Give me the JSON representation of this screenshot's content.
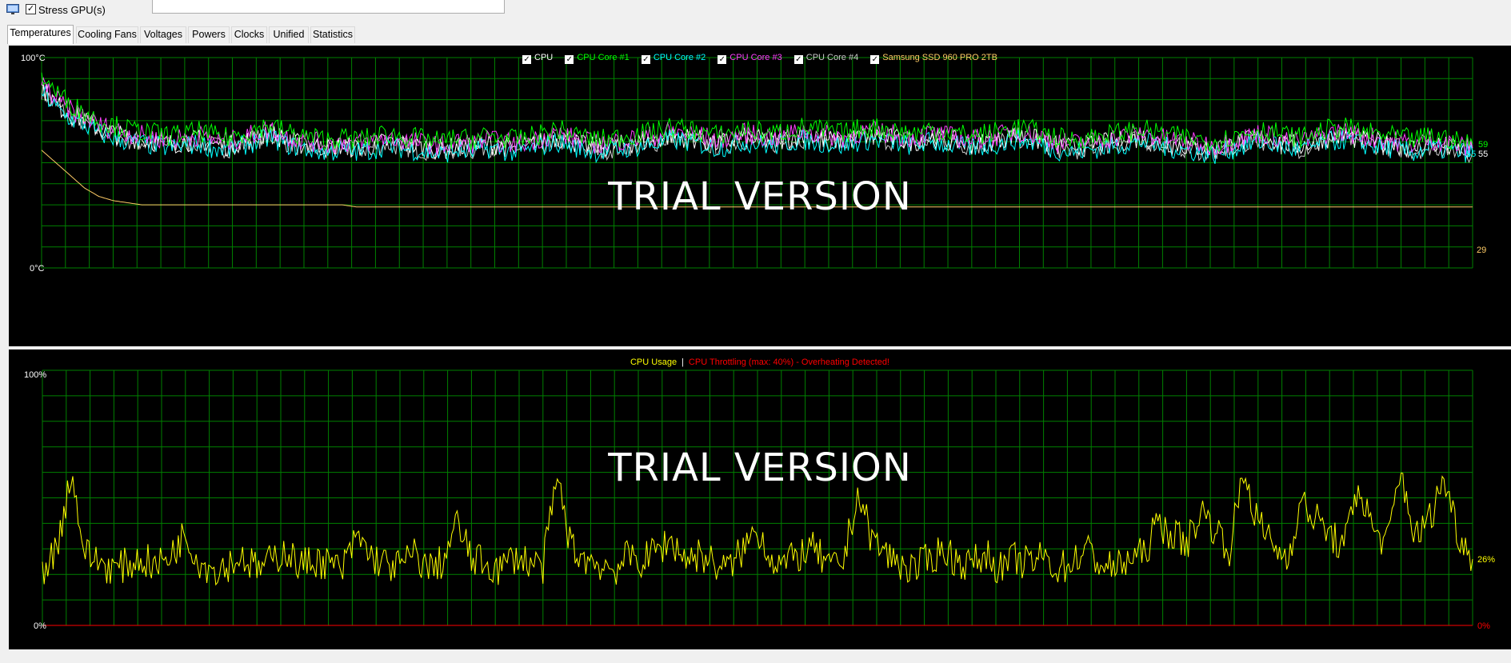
{
  "toolbar": {
    "stress_gpu_checked": true,
    "stress_gpu_label": "Stress GPU(s)"
  },
  "tabs": [
    {
      "label": "Temperatures",
      "active": true
    },
    {
      "label": "Cooling Fans"
    },
    {
      "label": "Voltages"
    },
    {
      "label": "Powers"
    },
    {
      "label": "Clocks"
    },
    {
      "label": "Unified"
    },
    {
      "label": "Statistics"
    }
  ],
  "temp_panel": {
    "legend": [
      {
        "label": "CPU",
        "color": "#ffffff",
        "checked": true
      },
      {
        "label": "CPU Core #1",
        "color": "#00ff00",
        "checked": true
      },
      {
        "label": "CPU Core #2",
        "color": "#00ffff",
        "checked": true
      },
      {
        "label": "CPU Core #3",
        "color": "#ff40ff",
        "checked": true
      },
      {
        "label": "CPU Core #4",
        "color": "#c8c8c8",
        "checked": true
      },
      {
        "label": "Samsung SSD 960 PRO 2TB",
        "color": "#ffcc66",
        "checked": true
      }
    ],
    "y_top_label": "100°C",
    "y_bottom_label": "0°C",
    "end_labels": [
      {
        "text": "59",
        "color": "#00ff00"
      },
      {
        "text": "55",
        "color": "#00ffff"
      },
      {
        "text": "55",
        "color": "#ffffff"
      },
      {
        "text": "29",
        "color": "#ffcc66"
      }
    ],
    "watermark": "TRIAL VERSION"
  },
  "cpu_panel": {
    "legend_usage": "CPU Usage",
    "legend_separator": "|",
    "legend_throttle": "CPU Throttling (max: 40%) - Overheating Detected!",
    "usage_color": "#ffff00",
    "throttle_color": "#ff0000",
    "y_top_label": "100%",
    "y_bottom_label": "0%",
    "end_usage_label": "26%",
    "end_throttle_label": "0%",
    "watermark": "TRIAL VERSION"
  },
  "chart_data": [
    {
      "type": "line",
      "title": "",
      "ylabel": "",
      "ylim": [
        0,
        100
      ],
      "grid": true,
      "legend_placement": "top-center",
      "series": [
        {
          "name": "CPU",
          "values": [
            86,
            78,
            73,
            70,
            66,
            64,
            62,
            61,
            60,
            59,
            60,
            61,
            59,
            58,
            60,
            62,
            64,
            61,
            59,
            58,
            57,
            58,
            57,
            58,
            60,
            59,
            58,
            57,
            56,
            58,
            57,
            59,
            58,
            57,
            58,
            60,
            62,
            60,
            58,
            57,
            58,
            59,
            60,
            61,
            63,
            62,
            61,
            59,
            60,
            62,
            61,
            60,
            61,
            63,
            62,
            61,
            60,
            62,
            63,
            62,
            61,
            60,
            62,
            61,
            60,
            59,
            60,
            61,
            63,
            62,
            60,
            58,
            57,
            58,
            59,
            60,
            61,
            62,
            60,
            59,
            58,
            57,
            56,
            58,
            60,
            62,
            61,
            59,
            58,
            60,
            62,
            63,
            61,
            60,
            59,
            58,
            57,
            59,
            58,
            56,
            55
          ]
        },
        {
          "name": "CPU Core #1",
          "values": [
            92,
            84,
            78,
            74,
            70,
            68,
            66,
            65,
            64,
            63,
            64,
            65,
            63,
            62,
            64,
            66,
            68,
            65,
            63,
            62,
            61,
            62,
            61,
            62,
            64,
            63,
            62,
            61,
            60,
            62,
            61,
            63,
            62,
            61,
            62,
            64,
            66,
            64,
            62,
            61,
            62,
            63,
            64,
            65,
            67,
            66,
            65,
            63,
            64,
            66,
            65,
            64,
            65,
            67,
            66,
            65,
            64,
            66,
            67,
            66,
            65,
            64,
            66,
            65,
            64,
            63,
            64,
            65,
            67,
            66,
            64,
            62,
            61,
            62,
            63,
            64,
            65,
            66,
            64,
            63,
            62,
            61,
            60,
            62,
            64,
            66,
            65,
            63,
            62,
            64,
            66,
            67,
            65,
            64,
            63,
            62,
            61,
            63,
            62,
            60,
            59
          ]
        },
        {
          "name": "CPU Core #2",
          "values": [
            84,
            76,
            71,
            68,
            64,
            62,
            60,
            59,
            58,
            57,
            58,
            59,
            57,
            56,
            58,
            60,
            62,
            59,
            57,
            56,
            55,
            56,
            55,
            56,
            58,
            57,
            56,
            55,
            54,
            56,
            55,
            57,
            56,
            55,
            56,
            58,
            60,
            58,
            56,
            55,
            56,
            57,
            58,
            59,
            61,
            60,
            59,
            57,
            58,
            60,
            59,
            58,
            59,
            61,
            60,
            59,
            58,
            60,
            61,
            60,
            59,
            58,
            60,
            59,
            58,
            57,
            58,
            59,
            61,
            60,
            58,
            56,
            55,
            56,
            57,
            58,
            59,
            60,
            58,
            57,
            56,
            55,
            54,
            56,
            58,
            60,
            59,
            57,
            56,
            58,
            60,
            61,
            59,
            58,
            57,
            56,
            55,
            57,
            56,
            55,
            55
          ]
        },
        {
          "name": "CPU Core #3",
          "values": [
            88,
            80,
            75,
            72,
            68,
            66,
            64,
            63,
            62,
            61,
            62,
            63,
            61,
            60,
            62,
            64,
            66,
            63,
            61,
            60,
            59,
            60,
            59,
            60,
            62,
            61,
            60,
            59,
            58,
            60,
            59,
            61,
            60,
            59,
            60,
            62,
            64,
            62,
            60,
            59,
            60,
            61,
            62,
            63,
            65,
            64,
            63,
            61,
            62,
            64,
            63,
            62,
            63,
            65,
            64,
            63,
            62,
            64,
            65,
            64,
            63,
            62,
            64,
            63,
            62,
            61,
            62,
            63,
            65,
            64,
            62,
            60,
            59,
            60,
            61,
            62,
            63,
            64,
            62,
            61,
            60,
            59,
            58,
            60,
            62,
            64,
            63,
            61,
            60,
            62,
            64,
            65,
            63,
            62,
            61,
            60,
            59,
            61,
            60,
            58,
            57
          ]
        },
        {
          "name": "CPU Core #4",
          "values": [
            85,
            77,
            72,
            69,
            65,
            63,
            61,
            60,
            59,
            58,
            59,
            60,
            58,
            57,
            59,
            61,
            63,
            60,
            58,
            57,
            56,
            57,
            56,
            57,
            59,
            58,
            57,
            56,
            55,
            57,
            56,
            58,
            57,
            56,
            57,
            59,
            61,
            59,
            57,
            56,
            57,
            58,
            59,
            60,
            62,
            61,
            60,
            58,
            59,
            61,
            60,
            59,
            60,
            62,
            61,
            60,
            59,
            61,
            62,
            61,
            60,
            59,
            61,
            60,
            59,
            58,
            59,
            60,
            62,
            61,
            59,
            57,
            56,
            57,
            58,
            59,
            60,
            61,
            59,
            58,
            57,
            56,
            55,
            57,
            59,
            61,
            60,
            58,
            57,
            59,
            61,
            62,
            60,
            59,
            58,
            57,
            56,
            58,
            57,
            56,
            55
          ]
        },
        {
          "name": "Samsung SSD 960 PRO 2TB",
          "values": [
            56,
            50,
            44,
            38,
            34,
            32,
            31,
            30,
            30,
            30,
            30,
            30,
            30,
            30,
            30,
            30,
            30,
            30,
            30,
            30,
            30,
            30,
            29,
            29,
            29,
            29,
            29,
            29,
            29,
            29,
            29,
            29,
            29,
            29,
            29,
            29,
            29,
            29,
            29,
            29,
            29,
            29,
            29,
            29,
            29,
            29,
            29,
            29,
            29,
            29,
            29,
            29,
            29,
            29,
            29,
            29,
            29,
            29,
            29,
            29,
            29,
            29,
            29,
            29,
            29,
            29,
            29,
            29,
            29,
            29,
            29,
            29,
            29,
            29,
            29,
            29,
            29,
            29,
            29,
            29,
            29,
            29,
            29,
            29,
            29,
            29,
            29,
            29,
            29,
            29,
            29,
            29,
            29,
            29,
            29,
            29,
            29,
            29,
            29,
            29,
            29
          ]
        }
      ]
    },
    {
      "type": "line",
      "title": "",
      "ylabel": "",
      "ylim": [
        0,
        100
      ],
      "grid": true,
      "legend_placement": "top-center",
      "series": [
        {
          "name": "CPU Usage",
          "values": [
            22,
            30,
            60,
            28,
            25,
            22,
            24,
            26,
            23,
            28,
            36,
            25,
            22,
            24,
            27,
            22,
            25,
            30,
            23,
            26,
            24,
            22,
            35,
            27,
            24,
            23,
            28,
            22,
            25,
            40,
            26,
            24,
            22,
            27,
            25,
            23,
            58,
            30,
            26,
            24,
            22,
            27,
            25,
            30,
            33,
            26,
            28,
            24,
            22,
            30,
            38,
            26,
            24,
            28,
            30,
            22,
            25,
            52,
            34,
            28,
            24,
            22,
            26,
            30,
            25,
            24,
            28,
            22,
            26,
            24,
            27,
            22,
            25,
            30,
            24,
            22,
            26,
            28,
            40,
            36,
            32,
            45,
            38,
            30,
            60,
            40,
            32,
            26,
            48,
            42,
            36,
            30,
            55,
            38,
            32,
            60,
            34,
            42,
            58,
            36,
            26
          ]
        },
        {
          "name": "CPU Throttling",
          "values": [
            0,
            0,
            0,
            0,
            0,
            0,
            0,
            0,
            0,
            0,
            0,
            0,
            0,
            0,
            0,
            0,
            0,
            0,
            0,
            0,
            0,
            0,
            0,
            0,
            0,
            0,
            0,
            0,
            0,
            0,
            0,
            0,
            0,
            0,
            0,
            0,
            0,
            0,
            0,
            0,
            0,
            0,
            0,
            0,
            0,
            0,
            0,
            0,
            0,
            0,
            0,
            0,
            0,
            0,
            0,
            0,
            0,
            0,
            0,
            0,
            0,
            0,
            0,
            0,
            0,
            0,
            0,
            0,
            0,
            0,
            0,
            0,
            0,
            0,
            0,
            0,
            0,
            0,
            0,
            0,
            0,
            0,
            0,
            0,
            0,
            0,
            0,
            0,
            0,
            0,
            0,
            0,
            0,
            0,
            0,
            0,
            0,
            0,
            0,
            0,
            0
          ]
        }
      ]
    }
  ]
}
